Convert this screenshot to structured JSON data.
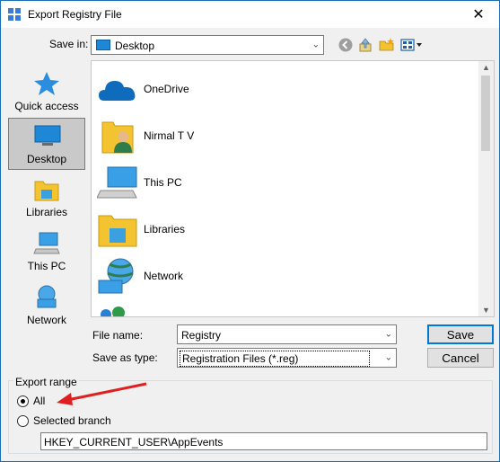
{
  "window": {
    "title": "Export Registry File",
    "close_glyph": "✕"
  },
  "toolbar": {
    "save_in_label": "Save in:",
    "save_in_value": "Desktop",
    "back_icon": "back-arrow-icon",
    "up_icon": "up-folder-icon",
    "new_folder_icon": "new-folder-icon",
    "view_icon": "view-menu-icon"
  },
  "places": [
    {
      "label": "Quick access",
      "icon": "star-icon"
    },
    {
      "label": "Desktop",
      "icon": "desktop-icon",
      "selected": true
    },
    {
      "label": "Libraries",
      "icon": "libraries-icon"
    },
    {
      "label": "This PC",
      "icon": "computer-icon"
    },
    {
      "label": "Network",
      "icon": "network-icon"
    }
  ],
  "files": [
    {
      "label": "OneDrive",
      "icon": "cloud-icon"
    },
    {
      "label": "Nirmal T V",
      "icon": "user-folder-icon"
    },
    {
      "label": "This PC",
      "icon": "computer-icon"
    },
    {
      "label": "Libraries",
      "icon": "libraries-icon"
    },
    {
      "label": "Network",
      "icon": "network-icon"
    }
  ],
  "form": {
    "file_name_label": "File name:",
    "file_name_value": "Registry",
    "save_as_type_label": "Save as type:",
    "save_as_type_value": "Registration Files (*.reg)",
    "save_button": "Save",
    "cancel_button": "Cancel"
  },
  "export_range": {
    "title": "Export range",
    "all_label": "All",
    "selected_branch_label": "Selected branch",
    "branch_value": "HKEY_CURRENT_USER\\AppEvents",
    "selected": "All"
  },
  "colors": {
    "accent": "#0078d7",
    "annotation_arrow": "#e02020"
  }
}
